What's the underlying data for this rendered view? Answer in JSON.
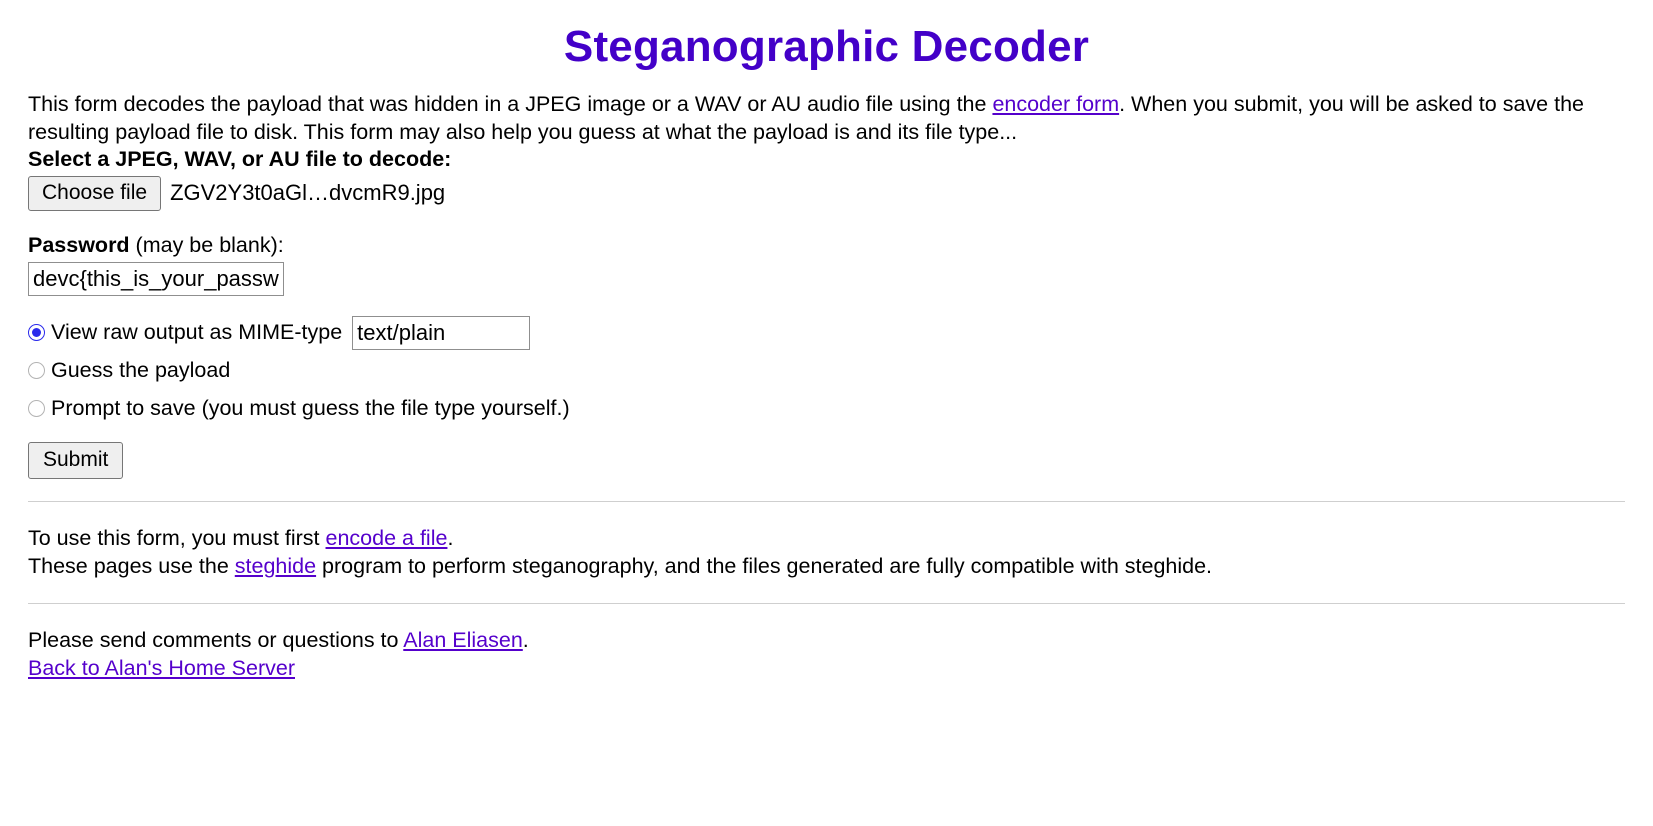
{
  "title": "Steganographic Decoder",
  "colors": {
    "title": "#4300c8",
    "link": "#5500cc",
    "radio_selected": "#2a2aec"
  },
  "intro": {
    "text_before_link": "This form decodes the payload that was hidden in a JPEG image or a WAV or AU audio file using the ",
    "link_label": "encoder form",
    "text_after_link": ". When you submit, you will be asked to save the resulting payload file to disk. This form may also help you guess at what the payload is and its file type..."
  },
  "file_field": {
    "label_bold": "Select a JPEG, WAV, or AU file to decode:",
    "choose_button_label": "Choose file",
    "selected_file_name": "ZGV2Y3t0aGl…dvcmR9.jpg"
  },
  "password_field": {
    "label_bold": "Password",
    "label_rest": " (may be blank):",
    "value": "devc{this_is_your_passw",
    "placeholder": ""
  },
  "output_options": [
    {
      "label": "View raw output as MIME-type",
      "selected": true,
      "has_input": true
    },
    {
      "label": "Guess the payload",
      "selected": false,
      "has_input": false
    },
    {
      "label": "Prompt to save (you must guess the file type yourself.)",
      "selected": false,
      "has_input": false
    }
  ],
  "mime_input": {
    "value": "text/plain",
    "placeholder": ""
  },
  "submit": {
    "label": "Submit"
  },
  "notes": {
    "encode_before": "To use this form, you must first ",
    "encode_link": "encode a file",
    "encode_after": ".",
    "steghide_before": "These pages use the ",
    "steghide_link": "steghide",
    "steghide_after": " program to perform steganography, and the files generated are fully compatible with steghide."
  },
  "footer": {
    "contact_before": "Please send comments or questions to ",
    "contact_link": "Alan Eliasen",
    "contact_after": ".",
    "home_link": "Back to Alan's Home Server"
  }
}
